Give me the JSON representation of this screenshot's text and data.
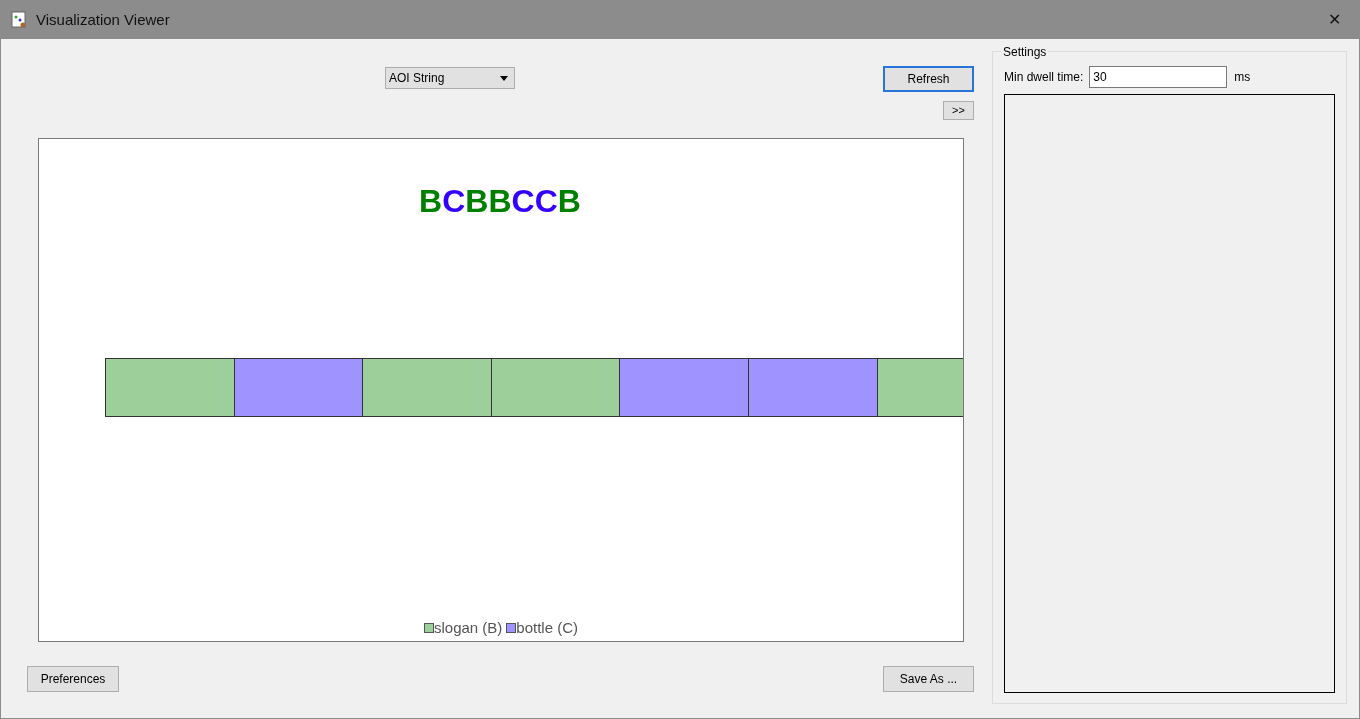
{
  "window": {
    "title": "Visualization Viewer",
    "close": "✕"
  },
  "view_select": {
    "value": "AOI String"
  },
  "buttons": {
    "refresh": "Refresh",
    "expand": ">>",
    "preferences": "Preferences",
    "save": "Save As ..."
  },
  "aoi_string": [
    {
      "letter": "B",
      "color": "#008000"
    },
    {
      "letter": "C",
      "color": "#3300ff"
    },
    {
      "letter": "B",
      "color": "#008000"
    },
    {
      "letter": "B",
      "color": "#008000"
    },
    {
      "letter": "C",
      "color": "#3300ff"
    },
    {
      "letter": "C",
      "color": "#3300ff"
    },
    {
      "letter": "B",
      "color": "#008000"
    }
  ],
  "segments": [
    {
      "color": "#9dcf9b"
    },
    {
      "color": "#9f94ff"
    },
    {
      "color": "#9dcf9b"
    },
    {
      "color": "#9dcf9b"
    },
    {
      "color": "#9f94ff"
    },
    {
      "color": "#9f94ff"
    },
    {
      "color": "#9dcf9b"
    }
  ],
  "legend": [
    {
      "label": "slogan (B)",
      "color": "#9dcf9b"
    },
    {
      "label": "bottle (C)",
      "color": "#9f94ff"
    }
  ],
  "settings": {
    "title": "Settings",
    "label": "Min dwell time:",
    "value": "30",
    "unit": "ms"
  }
}
